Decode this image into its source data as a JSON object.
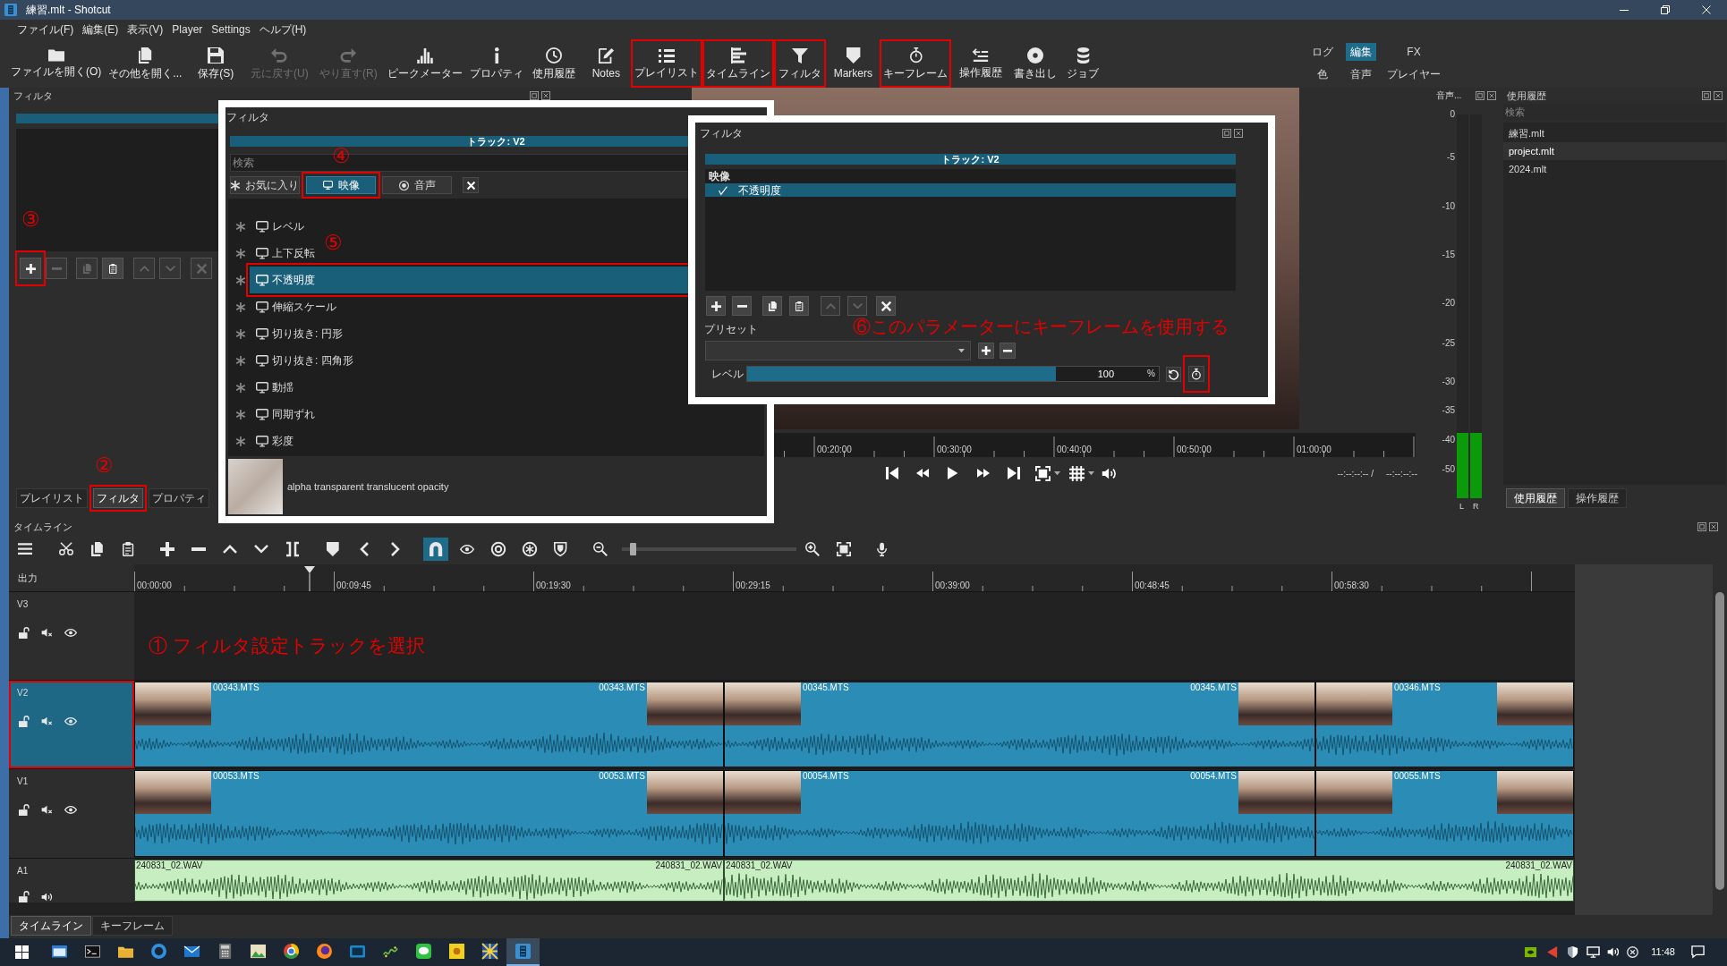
{
  "window": {
    "title": "練習.mlt - Shotcut"
  },
  "menu": [
    "ファイル(F)",
    "編集(E)",
    "表示(V)",
    "Player",
    "Settings",
    "ヘルプ(H)"
  ],
  "toolbar": [
    {
      "kind": "open",
      "label": "ファイルを開く(O)",
      "disabled": false,
      "marked": false
    },
    {
      "kind": "openmore",
      "label": "その他を開く...",
      "disabled": false,
      "marked": false
    },
    {
      "kind": "save",
      "label": "保存(S)",
      "disabled": false,
      "marked": false
    },
    {
      "kind": "undo",
      "label": "元に戻す(U)",
      "disabled": true,
      "marked": false
    },
    {
      "kind": "redo",
      "label": "やり直す(R)",
      "disabled": true,
      "marked": false
    },
    {
      "kind": "meter",
      "label": "ピークメーター",
      "disabled": false,
      "marked": false
    },
    {
      "kind": "info",
      "label": "プロパティ",
      "disabled": false,
      "marked": false
    },
    {
      "kind": "recent",
      "label": "使用履歴",
      "disabled": false,
      "marked": false
    },
    {
      "kind": "notes",
      "label": "Notes",
      "disabled": false,
      "marked": false
    },
    {
      "kind": "playlist",
      "label": "プレイリスト",
      "disabled": false,
      "marked": true
    },
    {
      "kind": "timeline",
      "label": "タイムライン",
      "disabled": false,
      "marked": true
    },
    {
      "kind": "filter",
      "label": "フィルタ",
      "disabled": false,
      "marked": true
    },
    {
      "kind": "markers",
      "label": "Markers",
      "disabled": false,
      "marked": false
    },
    {
      "kind": "keyframes",
      "label": "キーフレーム",
      "disabled": false,
      "marked": true
    },
    {
      "kind": "history",
      "label": "操作履歴",
      "disabled": false,
      "marked": false
    },
    {
      "kind": "export",
      "label": "書き出し",
      "disabled": false,
      "marked": false
    },
    {
      "kind": "jobs",
      "label": "ジョブ",
      "disabled": false,
      "marked": false
    }
  ],
  "layouts": [
    {
      "label": "ログ",
      "selected": false
    },
    {
      "label": "編集",
      "selected": true
    },
    {
      "label": "FX",
      "selected": false
    },
    {
      "label": "色",
      "selected": false
    },
    {
      "label": "音声",
      "selected": false
    },
    {
      "label": "プレイヤー",
      "selected": false
    }
  ],
  "filter_dock": {
    "title": "フィルタ",
    "tools": [
      {
        "kind": "add",
        "disabled": false,
        "marked": true
      },
      {
        "kind": "remove",
        "disabled": true,
        "marked": false
      },
      {
        "kind": "copy",
        "disabled": true,
        "marked": false
      },
      {
        "kind": "paste",
        "disabled": false,
        "marked": false
      },
      {
        "kind": "up",
        "disabled": true,
        "marked": false
      },
      {
        "kind": "down",
        "disabled": true,
        "marked": false
      },
      {
        "kind": "clear",
        "disabled": true,
        "marked": false
      }
    ],
    "tabs": [
      {
        "label": "プレイリスト",
        "selected": false,
        "marked": false
      },
      {
        "label": "フィルタ",
        "selected": true,
        "marked": true
      },
      {
        "label": "プロパティ",
        "selected": false,
        "marked": false
      }
    ]
  },
  "filter_picker": {
    "title": "フィルタ",
    "track": "トラック: V2",
    "search": {
      "placeholder": "検索"
    },
    "categories": [
      {
        "kind": "favorite",
        "label": "お気に入り",
        "selected": false,
        "marked": false
      },
      {
        "kind": "video",
        "label": "映像",
        "selected": true,
        "marked": true
      },
      {
        "kind": "audio",
        "label": "音声",
        "selected": false,
        "marked": false
      }
    ],
    "items": [
      {
        "label": "レベル",
        "selected": false,
        "marked": false
      },
      {
        "label": "上下反転",
        "selected": false,
        "marked": false
      },
      {
        "label": "不透明度",
        "selected": true,
        "marked": true
      },
      {
        "label": "伸縮スケール",
        "selected": false,
        "marked": false
      },
      {
        "label": "切り抜き: 円形",
        "selected": false,
        "marked": false
      },
      {
        "label": "切り抜き: 四角形",
        "selected": false,
        "marked": false
      },
      {
        "label": "動揺",
        "selected": false,
        "marked": false
      },
      {
        "label": "同期ずれ",
        "selected": false,
        "marked": false
      },
      {
        "label": "彩度",
        "selected": false,
        "marked": false
      }
    ],
    "description": "alpha transparent translucent opacity"
  },
  "filter_editor": {
    "title": "フィルタ",
    "track": "トラック: V2",
    "group": "映像",
    "filters": [
      {
        "label": "不透明度",
        "checked": true,
        "selected": true
      }
    ],
    "tools": [
      {
        "kind": "add",
        "disabled": false
      },
      {
        "kind": "remove",
        "disabled": false
      },
      {
        "kind": "copy",
        "disabled": false
      },
      {
        "kind": "paste",
        "disabled": false
      },
      {
        "kind": "up",
        "disabled": true
      },
      {
        "kind": "down",
        "disabled": true
      },
      {
        "kind": "clear",
        "disabled": false
      }
    ],
    "preset_label": "プリセット",
    "parameter": {
      "label": "レベル",
      "value": "100",
      "unit": "%",
      "level": 0.75,
      "keyframe_marked": true
    }
  },
  "player": {
    "ruler": [
      "00:20:00",
      "00:30:00",
      "00:40:00",
      "00:50:00",
      "01:00:00"
    ],
    "position": "--:--:--:-- /",
    "duration": "--:--:--:--"
  },
  "audio_meter": {
    "title": "音声...",
    "scale": [
      "0",
      "-5",
      "-10",
      "-15",
      "-20",
      "-25",
      "-30",
      "-35",
      "-40",
      "-50"
    ],
    "channels": [
      {
        "label": "L",
        "level": 0.17
      },
      {
        "label": "R",
        "level": 0.17
      }
    ]
  },
  "recent": {
    "title": "使用履歴",
    "search": {
      "placeholder": "検索"
    },
    "items": [
      {
        "label": "練習.mlt",
        "selected": false
      },
      {
        "label": "project.mlt",
        "selected": true
      },
      {
        "label": "2024.mlt",
        "selected": false
      }
    ],
    "tabs": [
      {
        "label": "使用履歴",
        "selected": true
      },
      {
        "label": "操作履歴",
        "selected": false
      }
    ]
  },
  "timeline": {
    "title": "タイムライン",
    "tools": [
      {
        "kind": "menu"
      },
      {
        "kind": "cut"
      },
      {
        "kind": "copy"
      },
      {
        "kind": "paste"
      },
      {
        "kind": "append"
      },
      {
        "kind": "remove"
      },
      {
        "kind": "lift"
      },
      {
        "kind": "overwrite"
      },
      {
        "kind": "split"
      },
      {
        "kind": "marker"
      },
      {
        "kind": "previous"
      },
      {
        "kind": "next"
      },
      {
        "kind": "snap",
        "on": true
      },
      {
        "kind": "scrub",
        "on": false
      },
      {
        "kind": "ripple",
        "on": false
      },
      {
        "kind": "rippleall",
        "on": false
      },
      {
        "kind": "ripplemarkers",
        "on": false
      },
      {
        "kind": "zoomout"
      },
      {
        "kind": "zoom",
        "level": 0.05
      },
      {
        "kind": "zoomin"
      },
      {
        "kind": "fit"
      },
      {
        "kind": "record"
      }
    ],
    "output_label": "出力",
    "ruler": [
      "00:00:00",
      "00:09:45",
      "00:19:30",
      "00:29:15",
      "00:39:00",
      "00:48:45",
      "00:58:30"
    ],
    "tracks": [
      {
        "name": "V3",
        "kind": "video",
        "selected": false,
        "marked": false
      },
      {
        "name": "V2",
        "kind": "video",
        "selected": true,
        "marked": true,
        "clips": [
          {
            "start_label": "00343.MTS",
            "end_label": "00343.MTS"
          },
          {
            "start_label": "00345.MTS",
            "end_label": "00345.MTS"
          },
          {
            "start_label": "00346.MTS"
          }
        ]
      },
      {
        "name": "V1",
        "kind": "video",
        "selected": false,
        "marked": false,
        "clips": [
          {
            "start_label": "00053.MTS",
            "end_label": "00053.MTS"
          },
          {
            "start_label": "00054.MTS",
            "end_label": "00054.MTS"
          },
          {
            "start_label": "00055.MTS"
          }
        ]
      },
      {
        "name": "A1",
        "kind": "audio",
        "selected": false,
        "marked": false,
        "clips": [
          {
            "start_label": "240831_02.WAV",
            "end_label": "240831_02.WAV"
          },
          {
            "start_label": "240831_02.WAV",
            "end_label": "240831_02.WAV"
          }
        ]
      }
    ]
  },
  "bottom_tabs": [
    {
      "label": "タイムライン",
      "selected": true
    },
    {
      "label": "キーフレーム",
      "selected": false
    }
  ],
  "annotations": [
    {
      "text": "④"
    },
    {
      "text": "③"
    },
    {
      "text": "⑤"
    },
    {
      "text": "⑥このパラメーターにキーフレームを使用する"
    },
    {
      "text": "②"
    },
    {
      "text": "① フィルタ設定トラックを選択"
    }
  ],
  "taskbar": {
    "apps": [
      {
        "kind": "window",
        "active": false
      },
      {
        "kind": "terminal",
        "active": false
      },
      {
        "kind": "folder",
        "active": false
      },
      {
        "kind": "ring",
        "active": false
      },
      {
        "kind": "mail",
        "active": false
      },
      {
        "kind": "calculator",
        "active": false
      },
      {
        "kind": "picture",
        "active": false
      },
      {
        "kind": "circle",
        "active": false
      },
      {
        "kind": "globe",
        "active": false
      },
      {
        "kind": "monitor",
        "active": false
      },
      {
        "kind": "squiggle",
        "active": false
      },
      {
        "kind": "bubble",
        "active": false
      },
      {
        "kind": "sun",
        "active": false
      },
      {
        "kind": "pattern",
        "active": false
      },
      {
        "kind": "logo",
        "active": true
      }
    ],
    "clock": "11:48"
  }
}
